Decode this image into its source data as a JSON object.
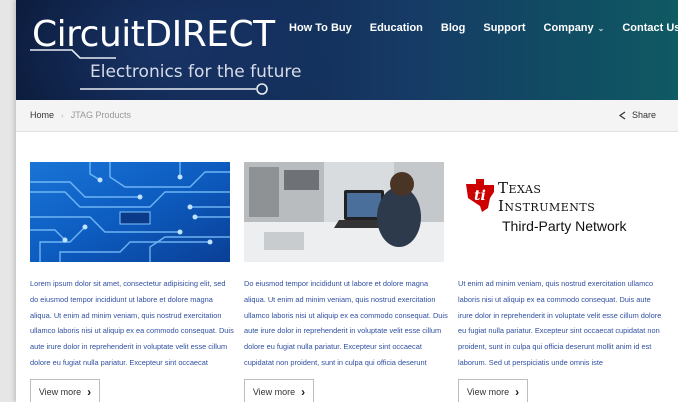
{
  "brand": {
    "name": "CircuitDIRECT",
    "tagline": "Electronics for the future"
  },
  "nav": {
    "items": [
      {
        "label": "How To Buy"
      },
      {
        "label": "Education"
      },
      {
        "label": "Blog"
      },
      {
        "label": "Support"
      },
      {
        "label": "Company",
        "dropdown": true
      },
      {
        "label": "Contact Us"
      }
    ]
  },
  "breadcrumb": {
    "home": "Home",
    "current": "JTAG Products",
    "share_label": "Share"
  },
  "cards": [
    {
      "text": "Lorem ipsum dolor sit amet, consectetur adipisicing elit, sed do eiusmod tempor incididunt ut labore et dolore magna aliqua. Ut enim ad minim veniam, quis nostrud exercitation ullamco laboris nisi ut aliquip ex ea commodo consequat. Duis aute irure dolor in reprehenderit in voluptate velit esse cillum dolore eu fugiat nulla pariatur. Excepteur sint occaecat",
      "button": "View more"
    },
    {
      "text": "Do eiusmod tempor incididunt ut labore et dolore magna aliqua. Ut enim ad minim veniam, quis nostrud exercitation ullamco laboris nisi ut aliquip ex ea commodo consequat. Duis aute irure dolor in reprehenderit in voluptate velit esse cillum dolore eu fugiat nulla pariatur. Excepteur sint occaecat cupidatat non proident, sunt in culpa qui officia deserunt",
      "button": "View more"
    },
    {
      "logo_line1": "Texas",
      "logo_line2": "Instruments",
      "logo_line3": "Third-Party Network",
      "text": "Ut enim ad minim veniam, quis nostrud exercitation ullamco laboris nisi ut aliquip ex ea commodo consequat. Duis aute irure dolor in reprehenderit in voluptate velit esse cillum dolore eu fugiat nulla pariatur. Excepteur sint occaecat cupidatat non proident, sunt in culpa qui officia deserunt mollit anim id est laborum. Sed ut perspiciatis unde omnis iste",
      "button": "View more"
    }
  ],
  "colors": {
    "body_text": "#2f4fa0",
    "ti_red": "#cc0000"
  }
}
